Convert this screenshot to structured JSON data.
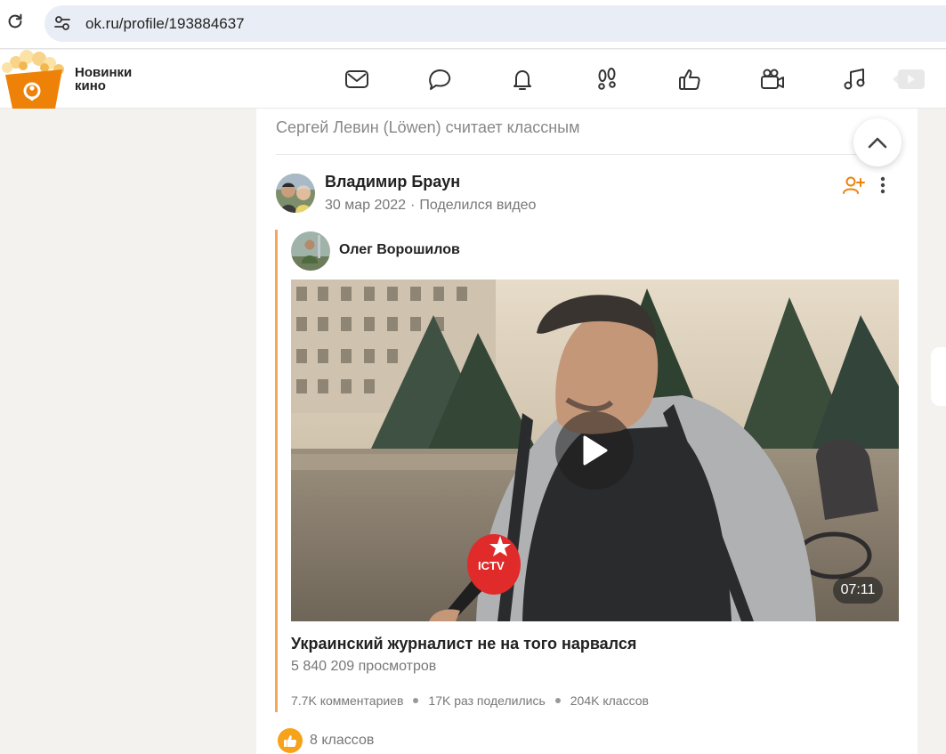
{
  "browser": {
    "url": "ok.ru/profile/193884637"
  },
  "header": {
    "promo_line1": "Новинки",
    "promo_line2": "кино",
    "nav_icons": [
      "mail-icon",
      "chat-icon",
      "bell-icon",
      "footprints-icon",
      "thumbs-up-icon",
      "video-camera-icon",
      "music-icon",
      "video-play-icon"
    ]
  },
  "feed": {
    "reason": "Сергей Левин (Löwen) считает классным",
    "post": {
      "author": "Владимир Браун",
      "date": "30 мар 2022",
      "action": "Поделился видео",
      "original_author": "Олег Ворошилов",
      "video": {
        "title": "Украинский журналист не на того нарвался",
        "views": "5 840 209 просмотров",
        "duration": "07:11",
        "mic_text": "ICTV",
        "comments": "7.7K комментариев",
        "shares": "17K раз поделились",
        "classes": "204K классов"
      },
      "likes": "8 классов"
    }
  },
  "colors": {
    "accent": "#ee8208",
    "share_border": "#f5a65b",
    "like": "#f7a21b"
  }
}
